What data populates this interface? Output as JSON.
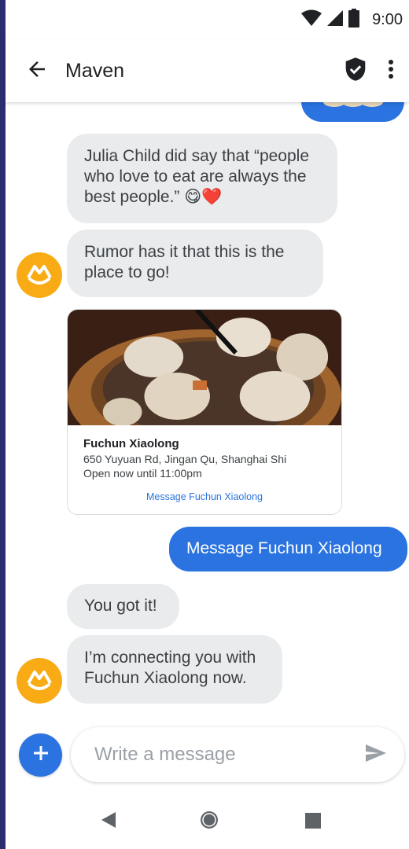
{
  "status_bar": {
    "time": "9:00",
    "icons": [
      "wifi-icon",
      "cell-signal-icon",
      "battery-icon"
    ]
  },
  "app_bar": {
    "title": "Maven",
    "icons": [
      "back-arrow-icon",
      "verified-shield-icon",
      "more-vert-icon"
    ]
  },
  "messages": [
    {
      "direction": "incoming",
      "text": "Julia Child did say that “people who love to eat are always the best people.” 😋❤️"
    },
    {
      "direction": "incoming",
      "text": "Rumor has it that this is the place to go!"
    },
    {
      "direction": "outgoing",
      "text": "Message Fuchun Xiaolong"
    },
    {
      "direction": "incoming",
      "text": "You got it!"
    },
    {
      "direction": "incoming",
      "text": "I’m connecting you with Fuchun Xiaolong now."
    }
  ],
  "rich_card": {
    "title": "Fuchun Xiaolong",
    "address": "650 Yuyuan Rd, Jingan Qu, Shanghai Shi",
    "hours": "Open now until 11:00pm",
    "action_label": "Message Fuchun Xiaolong"
  },
  "composer": {
    "placeholder": "Write a message"
  },
  "colors": {
    "accent": "#2a73e0",
    "incoming_bubble": "#e9ebed",
    "avatar": "#f8ab14"
  }
}
